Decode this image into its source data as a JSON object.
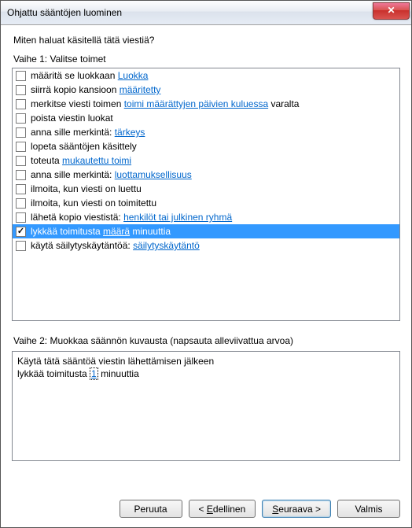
{
  "title": "Ohjattu sääntöjen luominen",
  "prompt": "Miten haluat käsitellä tätä viestiä?",
  "step1_label": "Vaihe 1: Valitse toimet",
  "step2_label": "Vaihe 2: Muokkaa säännön kuvausta (napsauta alleviivattua arvoa)",
  "actions": [
    {
      "checked": false,
      "pre": "määritä se luokkaan ",
      "link": "Luokka",
      "post": ""
    },
    {
      "checked": false,
      "pre": "siirrä kopio kansioon ",
      "link": "määritetty",
      "post": ""
    },
    {
      "checked": false,
      "pre": "merkitse viesti toimen ",
      "link": "toimi määrättyjen päivien kuluessa",
      "post": " varalta"
    },
    {
      "checked": false,
      "pre": "poista viestin luokat",
      "link": "",
      "post": ""
    },
    {
      "checked": false,
      "pre": "anna sille merkintä: ",
      "link": "tärkeys",
      "post": ""
    },
    {
      "checked": false,
      "pre": "lopeta sääntöjen käsittely",
      "link": "",
      "post": ""
    },
    {
      "checked": false,
      "pre": "toteuta ",
      "link": "mukautettu toimi",
      "post": ""
    },
    {
      "checked": false,
      "pre": "anna sille merkintä: ",
      "link": "luottamuksellisuus",
      "post": ""
    },
    {
      "checked": false,
      "pre": "ilmoita, kun viesti on luettu",
      "link": "",
      "post": ""
    },
    {
      "checked": false,
      "pre": "ilmoita, kun viesti on toimitettu",
      "link": "",
      "post": ""
    },
    {
      "checked": false,
      "pre": "lähetä kopio viestistä: ",
      "link": "henkilöt tai julkinen ryhmä",
      "post": ""
    },
    {
      "checked": true,
      "selected": true,
      "pre": "lykkää toimitusta ",
      "link": "määrä",
      "post": " minuuttia"
    },
    {
      "checked": false,
      "pre": "käytä säilytyskäytäntöä: ",
      "link": "säilytyskäytäntö",
      "post": ""
    }
  ],
  "desc": {
    "line1": "Käytä tätä sääntöä viestin lähettämisen jälkeen",
    "line2_pre": "lykkää toimitusta ",
    "line2_value": "1",
    "line2_post": " minuuttia"
  },
  "buttons": {
    "cancel": "Peruuta",
    "back_pre": "< ",
    "back_mn": "E",
    "back_post": "dellinen",
    "next_pre": "",
    "next_mn": "S",
    "next_post": "euraava >",
    "finish": "Valmis"
  }
}
